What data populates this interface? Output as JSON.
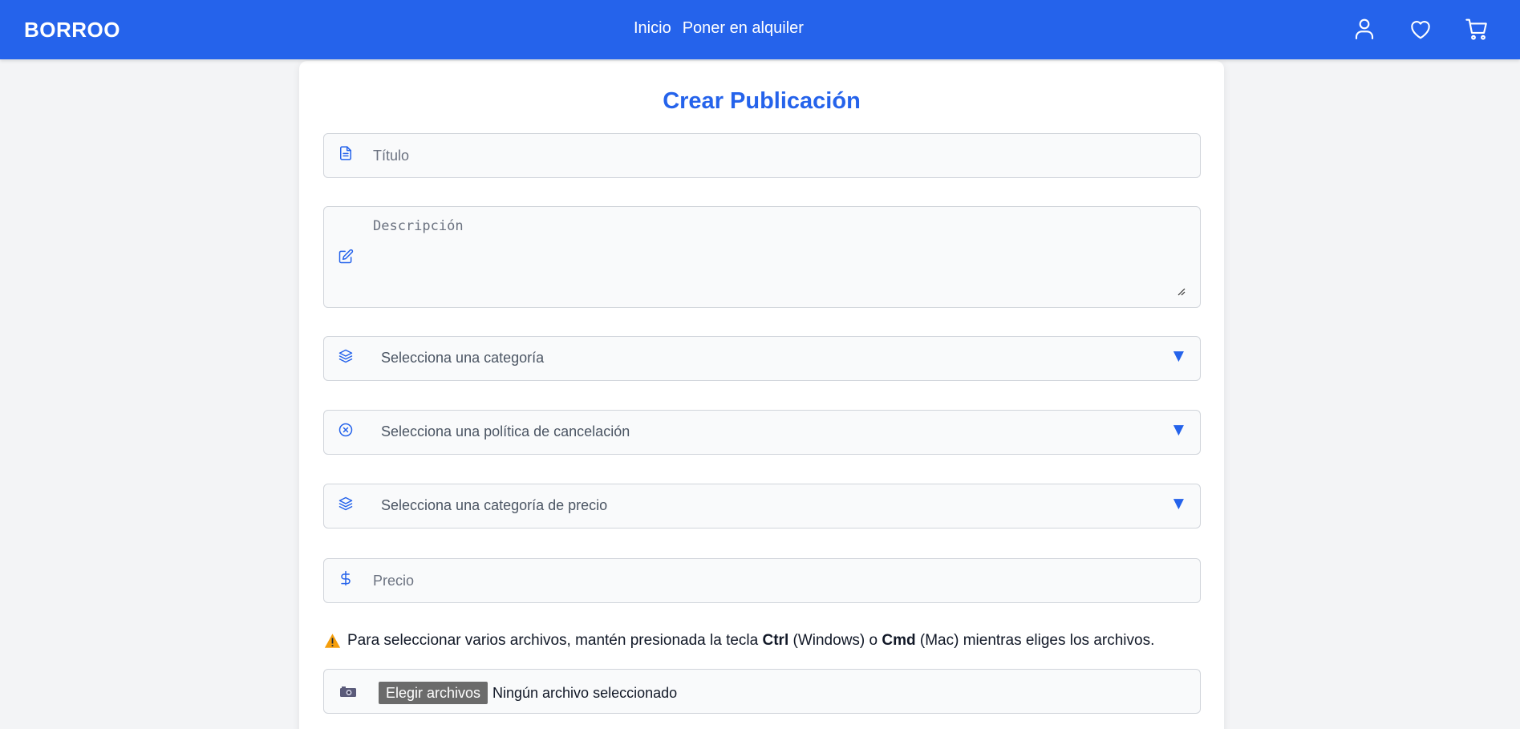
{
  "header": {
    "brand": "BORROO",
    "nav": [
      "Inicio",
      "Poner en alquiler"
    ],
    "icons": [
      "user-icon",
      "heart-icon",
      "cart-icon"
    ]
  },
  "form": {
    "title": "Crear Publicación",
    "fields": {
      "titulo_placeholder": "Título",
      "descripcion_placeholder": "Descripción",
      "categoria": "Selecciona una categoría",
      "politica": "Selecciona una política de cancelación",
      "categoria_precio": "Selecciona una categoría de precio",
      "precio_placeholder": "Precio"
    },
    "notice": {
      "prefix": "Para seleccionar varios archivos, mantén presionada la tecla ",
      "key1": "Ctrl",
      "mid1": " (Windows) o ",
      "key2": "Cmd",
      "suffix": " (Mac) mientras eliges los archivos."
    },
    "file_button": "Elegir archivos",
    "file_status": "Ningún archivo seleccionado"
  },
  "colors": {
    "primary": "#2563eb",
    "background": "#f3f4f6",
    "field_bg": "#f9fafb",
    "border": "#d1d5db"
  },
  "icons": {
    "title_field": "document-icon",
    "description_field": "edit-icon",
    "category_field": "layers-icon",
    "policy_field": "x-circle-icon",
    "price_category_field": "layers-icon",
    "price_field": "dollar-icon",
    "notice": "warning-icon",
    "file_field": "camera-icon"
  }
}
